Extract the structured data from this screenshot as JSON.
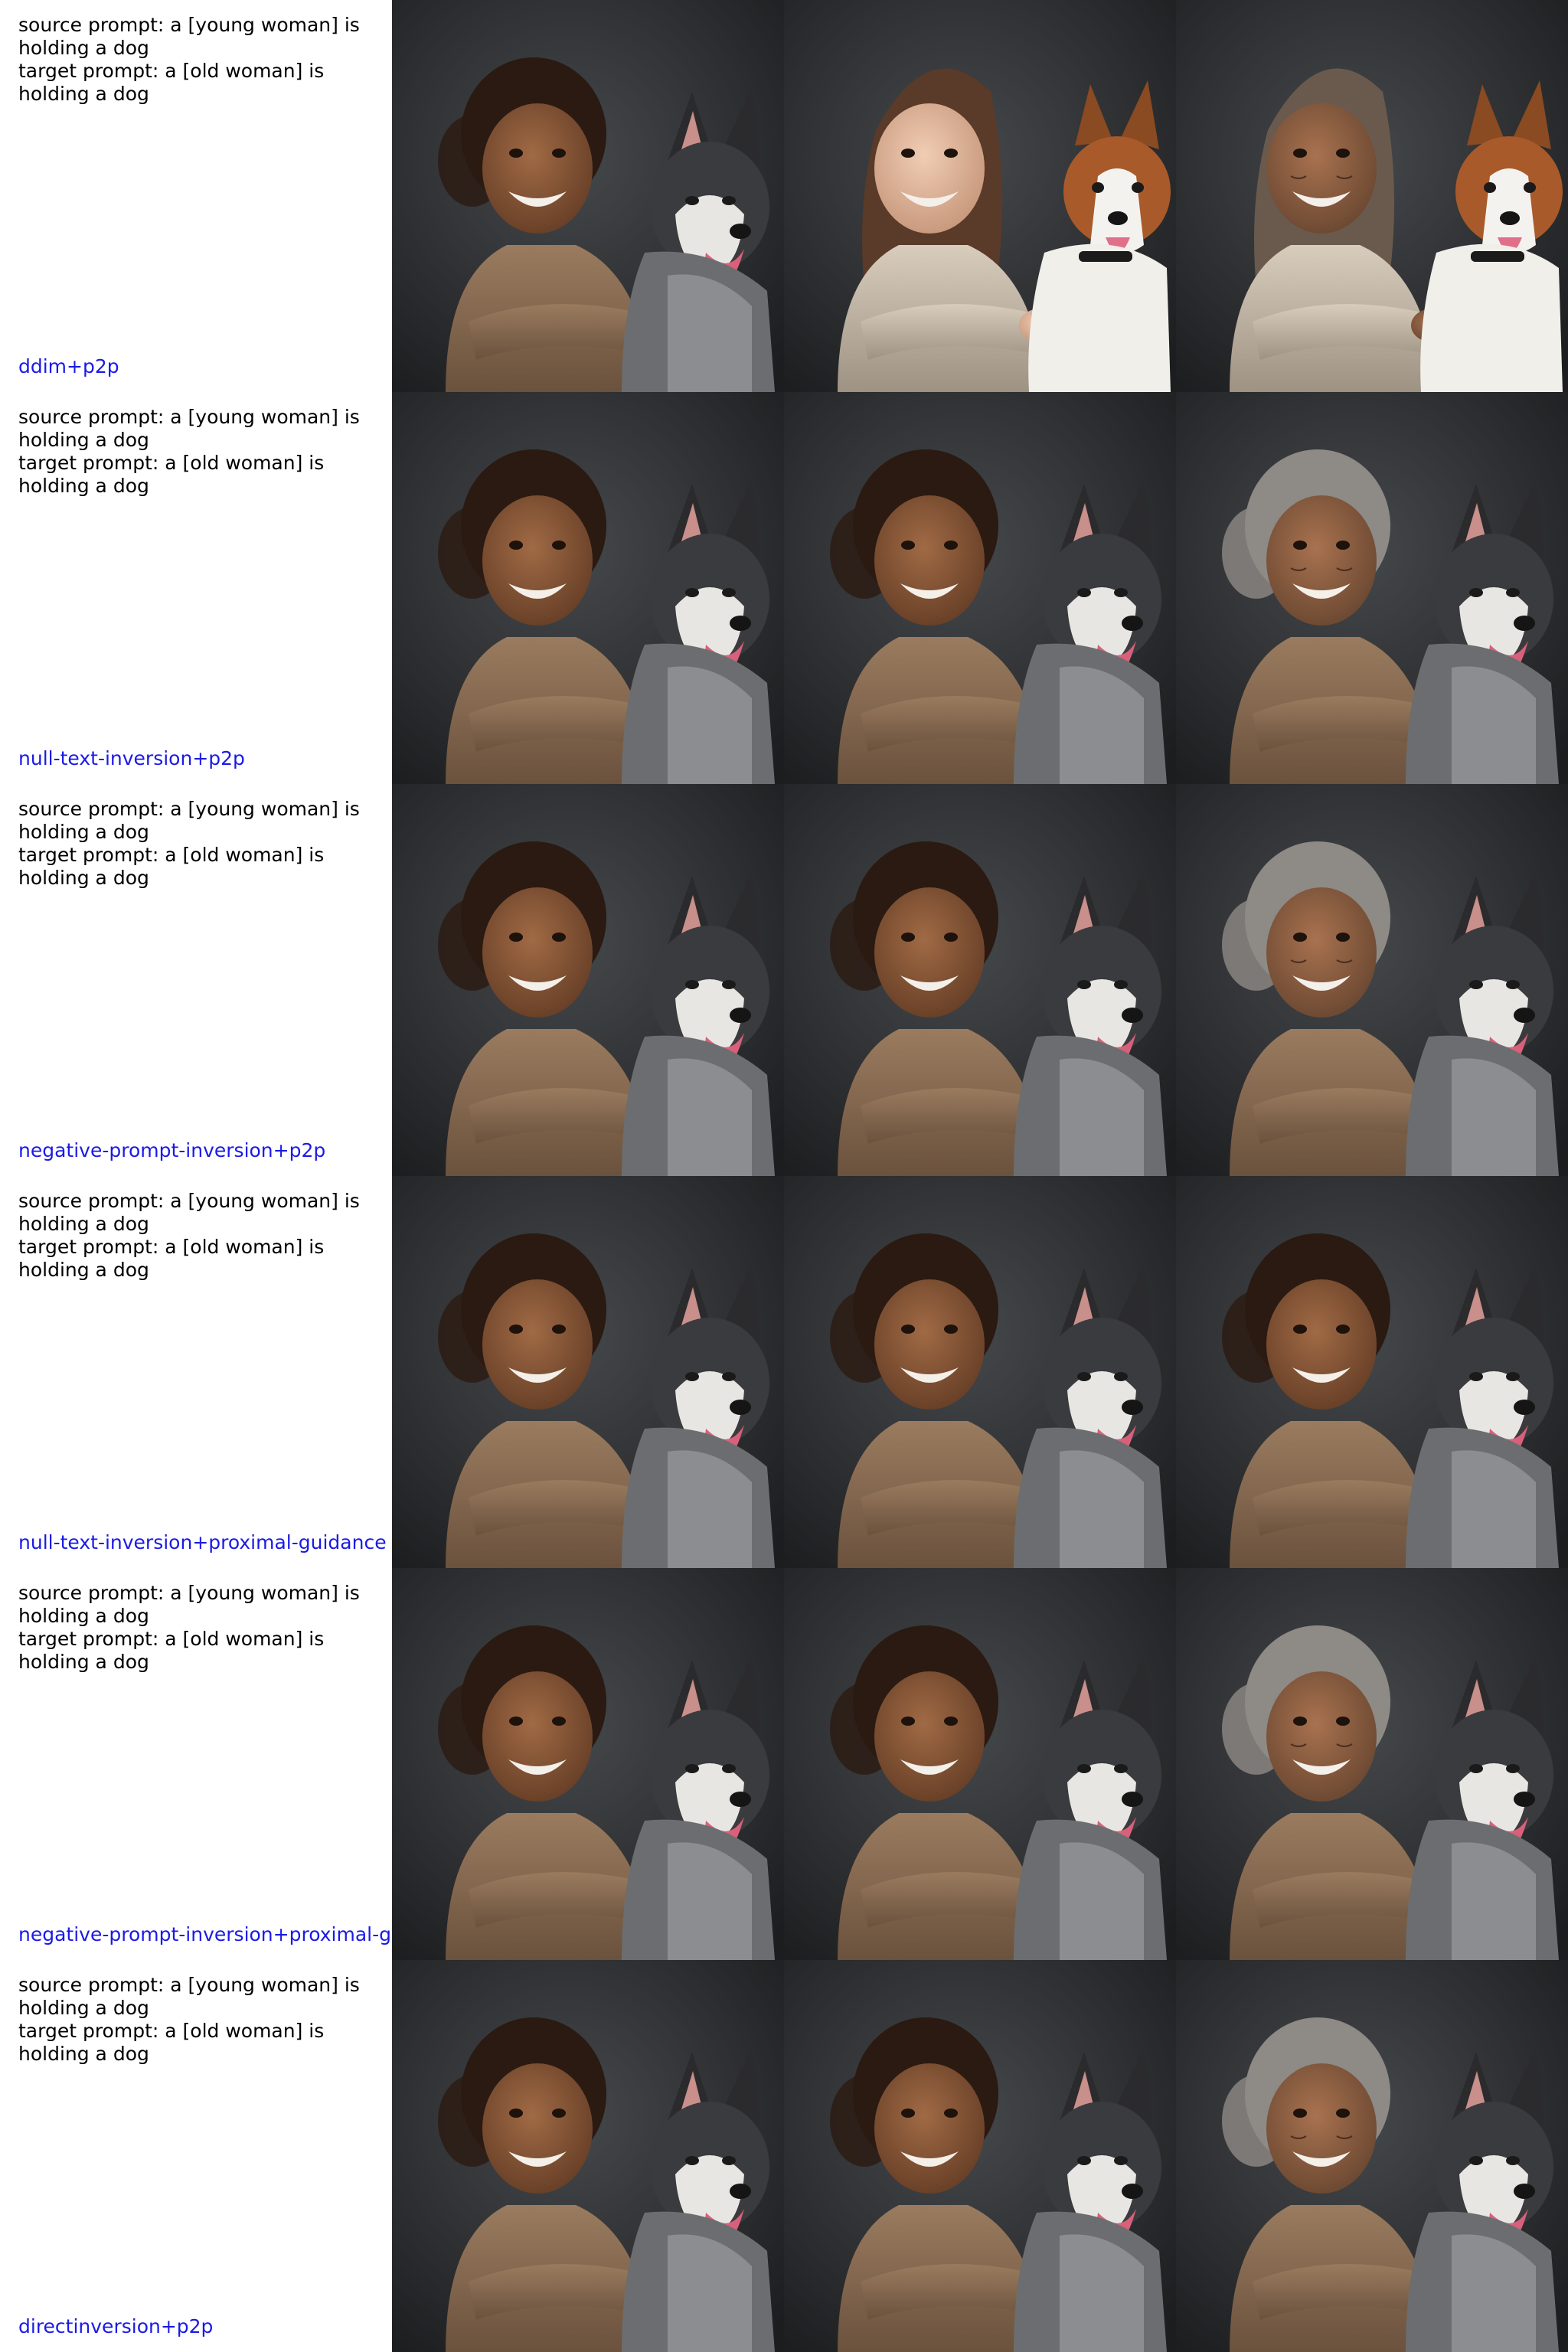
{
  "rows": [
    {
      "source_prompt": "source prompt: a [young woman] is holding a dog",
      "target_prompt": "target prompt: a [old woman] is holding a dog",
      "method": "ddim+p2p",
      "cells": [
        "girl-with-husky-photo",
        "young-woman-with-dog-photo",
        "old-woman-with-dog-photo"
      ]
    },
    {
      "source_prompt": "source prompt: a [young woman] is holding a dog",
      "target_prompt": "target prompt: a [old woman] is holding a dog",
      "method": "null-text-inversion+p2p",
      "cells": [
        "girl-with-husky-photo",
        "girl-with-husky-photo",
        "old-woman-with-husky-photo"
      ]
    },
    {
      "source_prompt": "source prompt: a [young woman] is holding a dog",
      "target_prompt": "target prompt: a [old woman] is holding a dog",
      "method": "negative-prompt-inversion+p2p",
      "cells": [
        "girl-with-husky-photo",
        "girl-with-husky-photo",
        "old-woman-with-husky-photo"
      ]
    },
    {
      "source_prompt": "source prompt: a [young woman] is holding a dog",
      "target_prompt": "target prompt: a [old woman] is holding a dog",
      "method": "null-text-inversion+proximal-guidance",
      "cells": [
        "girl-with-husky-photo",
        "girl-with-husky-photo",
        "girl-with-husky-photo"
      ]
    },
    {
      "source_prompt": "source prompt: a [young woman] is holding a dog",
      "target_prompt": "target prompt: a [old woman] is holding a dog",
      "method": "negative-prompt-inversion+proximal-guidance",
      "cells": [
        "girl-with-husky-photo",
        "girl-with-husky-photo",
        "old-woman-with-husky-photo"
      ]
    },
    {
      "source_prompt": "source prompt: a [young woman] is holding a dog",
      "target_prompt": "target prompt: a [old woman] is holding a dog",
      "method": "directinversion+p2p",
      "cells": [
        "girl-with-husky-photo",
        "girl-with-husky-photo",
        "old-woman-with-husky-photo"
      ]
    }
  ],
  "colors": {
    "background": "#ffffff",
    "prompt_text": "#000000",
    "method_label": "#1a1ae6",
    "photo_backdrop": "#2a2c2e"
  }
}
